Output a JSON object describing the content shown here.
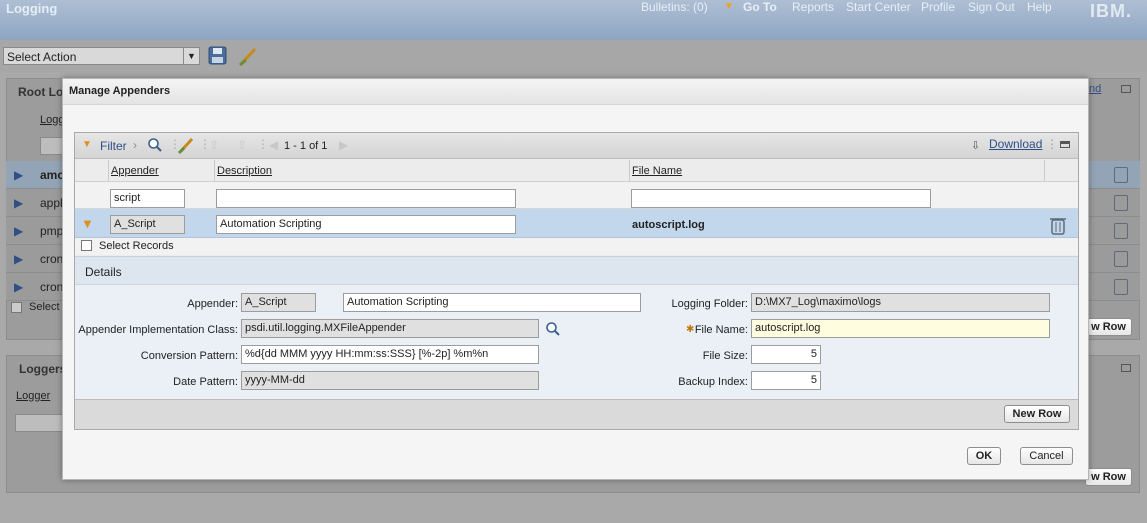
{
  "app": {
    "title": "Logging"
  },
  "topnav": {
    "bulletins": "Bulletins: (0)",
    "goto": "Go To",
    "reports": "Reports",
    "start_center": "Start Center",
    "profile": "Profile",
    "sign_out": "Sign Out",
    "help": "Help",
    "logo": "IBM."
  },
  "toolbar": {
    "select_action": "Select Action"
  },
  "background": {
    "root_section_title": "Root Lo",
    "logger_col": "Logge",
    "rows": [
      "amc",
      "appl",
      "pmp",
      "cron",
      "cron"
    ],
    "select_label": "Select",
    "new_row_partial": "w Row",
    "loggers_title": "Loggers",
    "logger_header": "Logger",
    "nd_partial": "nd"
  },
  "dialog": {
    "title": "Manage Appenders",
    "table": {
      "filter_label": "Filter",
      "pagination": "1 - 1 of 1",
      "download": "Download",
      "columns": {
        "appender": "Appender",
        "description": "Description",
        "file_name": "File Name"
      },
      "filter_values": {
        "appender": "script",
        "description": "",
        "file_name": ""
      },
      "row": {
        "appender": "A_Script",
        "description": "Automation Scripting",
        "file_name": "autoscript.log"
      },
      "select_records": "Select Records"
    },
    "details": {
      "title": "Details",
      "appender_label": "Appender:",
      "appender_value": "A_Script",
      "appender_desc": "Automation Scripting",
      "impl_class_label": "Appender Implementation Class:",
      "impl_class_value": "psdi.util.logging.MXFileAppender",
      "conversion_label": "Conversion Pattern:",
      "conversion_value": "%d{dd MMM yyyy HH:mm:ss:SSS} [%-2p] %m%n",
      "date_pattern_label": "Date Pattern:",
      "date_pattern_value": "yyyy-MM-dd",
      "logging_folder_label": "Logging Folder:",
      "logging_folder_value": "D:\\MX7_Log\\maximo\\logs",
      "file_name_label": "File Name:",
      "file_name_value": "autoscript.log",
      "file_size_label": "File Size:",
      "file_size_value": "5",
      "backup_index_label": "Backup Index:",
      "backup_index_value": "5"
    },
    "new_row": "New Row",
    "ok": "OK",
    "cancel": "Cancel"
  }
}
